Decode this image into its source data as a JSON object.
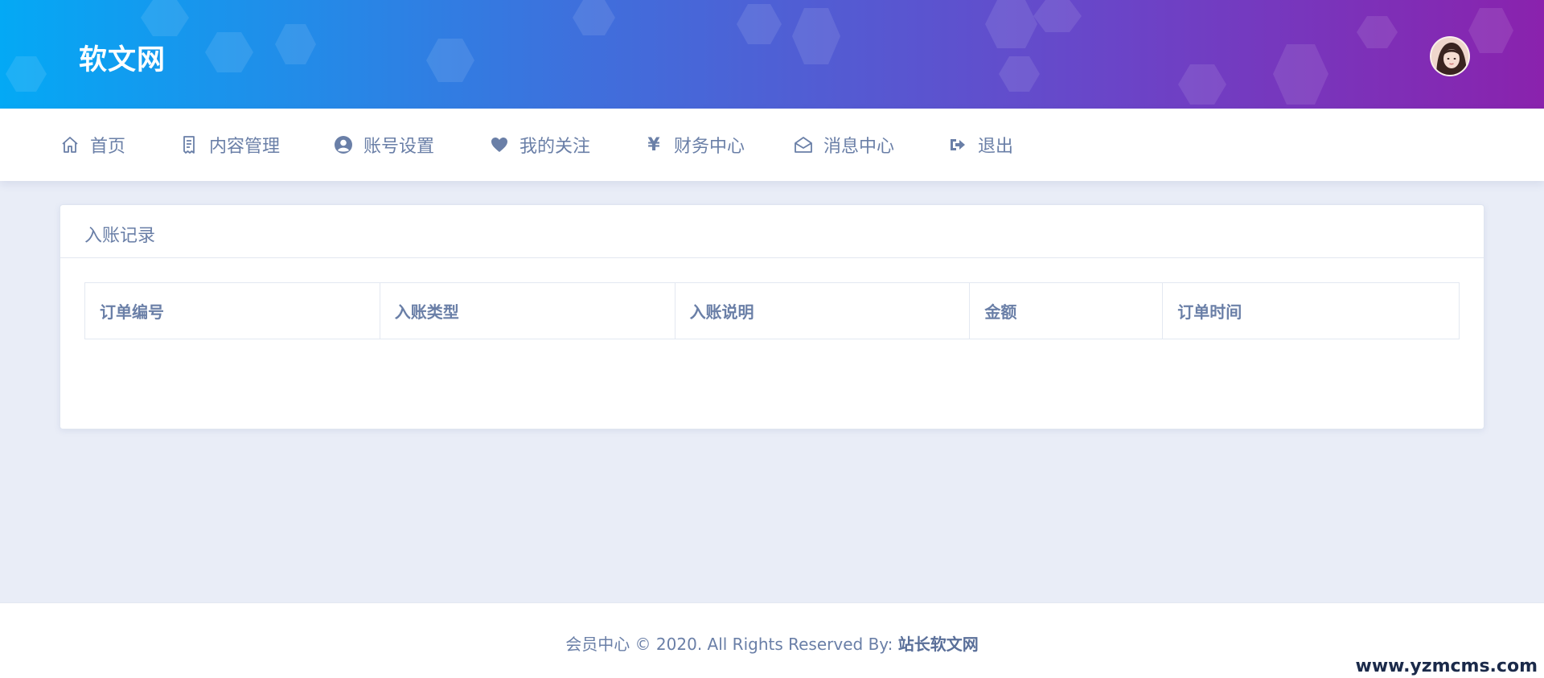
{
  "header": {
    "brand": "软文网",
    "gradient": [
      "#04a9f5",
      "#3f6fdc",
      "#6a45c8",
      "#8a22ad"
    ]
  },
  "nav": {
    "items": [
      {
        "label": "首页",
        "icon": "home-icon"
      },
      {
        "label": "内容管理",
        "icon": "receipt-icon"
      },
      {
        "label": "账号设置",
        "icon": "user-circle-icon"
      },
      {
        "label": "我的关注",
        "icon": "heart-icon"
      },
      {
        "label": "财务中心",
        "icon": "yen-icon",
        "glyph": "¥"
      },
      {
        "label": "消息中心",
        "icon": "envelope-open-icon"
      },
      {
        "label": "退出",
        "icon": "sign-out-icon"
      }
    ]
  },
  "card": {
    "title": "入账记录",
    "table": {
      "columns": [
        "订单编号",
        "入账类型",
        "入账说明",
        "金额",
        "订单时间"
      ],
      "rows": []
    }
  },
  "footer": {
    "prefix": "会员中心 © 2020. All Rights Reserved By: ",
    "owner": "站长软文网"
  },
  "watermark": "www.yzmcms.com",
  "colors": {
    "text": "#6a7fa7",
    "page_bg": "#e9edf7"
  }
}
